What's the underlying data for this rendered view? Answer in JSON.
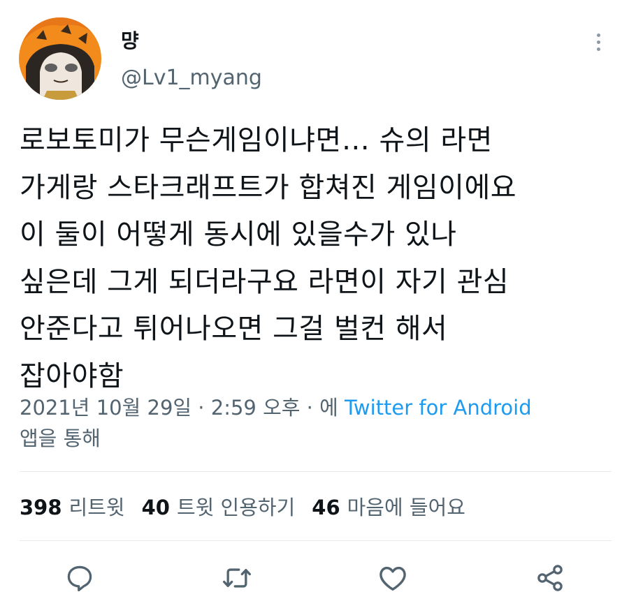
{
  "user": {
    "display_name": "먕",
    "handle": "@Lv1_myang"
  },
  "tweet": {
    "text": "로보토미가 무슨게임이냐면… 슈의 라면\n가게랑 스타크래프트가 합쳐진 게임이에요\n이 둘이 어떻게 동시에 있을수가 있나\n싶은데 그게 되더라구요 라면이 자기 관심\n안준다고 튀어나오면 그걸 벌컨 해서\n잡아야함"
  },
  "meta": {
    "timestamp": "2021년 10월 29일 · 2:59 오후 · 에 ",
    "source": "Twitter for Android",
    "suffix": "앱을 통해"
  },
  "stats": {
    "retweets": {
      "count": "398",
      "label": "리트윗"
    },
    "quotes": {
      "count": "40",
      "label": "트윗 인용하기"
    },
    "likes": {
      "count": "46",
      "label": "마음에 들어요"
    }
  },
  "icons": {
    "reply": "reply-icon",
    "retweet": "retweet-icon",
    "like": "heart-icon",
    "share": "share-icon",
    "more": "more-vertical-icon"
  },
  "colors": {
    "text": "#0f1419",
    "secondary": "#536471",
    "link": "#1d9bf0",
    "divider": "#e7e9ec"
  }
}
